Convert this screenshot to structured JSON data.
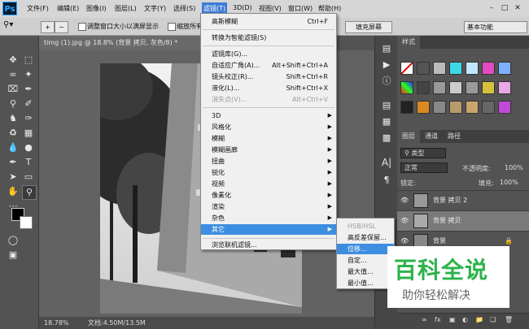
{
  "app": {
    "logo": "Ps"
  },
  "menubar": {
    "items": [
      "文件(F)",
      "编辑(E)",
      "图像(I)",
      "图层(L)",
      "文字(Y)",
      "选择(S)",
      "滤镜(T)",
      "3D(D)",
      "视图(V)",
      "窗口(W)",
      "帮助(H)"
    ],
    "active": "滤镜(T)"
  },
  "options": {
    "resize_windows": "调整窗口大小以满屏显示",
    "zoom_all": "缩放所有窗口",
    "fill_screen": "填充屏幕",
    "workspace": "基本功能"
  },
  "document": {
    "tab_title": "timg (1).jpg @ 18.8% (背景 拷贝, 灰色/8) *",
    "zoom": "18.78%",
    "doc_size": "文档:4.50M/13.5M"
  },
  "filter_menu": {
    "items": [
      {
        "label": "高斯模糊",
        "shortcut": "Ctrl+F"
      },
      {
        "label": "转换为智能滤镜(S)"
      },
      {
        "label": "滤镜库(G)..."
      },
      {
        "label": "自适应广角(A)...",
        "shortcut": "Alt+Shift+Ctrl+A"
      },
      {
        "label": "镜头校正(R)...",
        "shortcut": "Shift+Ctrl+R"
      },
      {
        "label": "液化(L)...",
        "shortcut": "Shift+Ctrl+X"
      },
      {
        "label": "消失点(V)...",
        "shortcut": "Alt+Ctrl+V"
      },
      {
        "label": "3D"
      },
      {
        "label": "风格化"
      },
      {
        "label": "模糊"
      },
      {
        "label": "模糊画廊"
      },
      {
        "label": "扭曲"
      },
      {
        "label": "锐化"
      },
      {
        "label": "视频"
      },
      {
        "label": "像素化"
      },
      {
        "label": "渲染"
      },
      {
        "label": "杂色"
      },
      {
        "label": "其它"
      },
      {
        "label": "浏览联机滤镜..."
      }
    ]
  },
  "other_submenu": {
    "items": [
      "HSB/HSL",
      "高反差保留...",
      "位移...",
      "自定...",
      "最大值...",
      "最小值..."
    ]
  },
  "styles_panel": {
    "title": "样式"
  },
  "layers_panel": {
    "tabs": [
      "图层",
      "通道",
      "路径"
    ],
    "kind_label": "类型",
    "blend_mode": "正常",
    "opacity_label": "不透明度:",
    "opacity_value": "100%",
    "lock_label": "锁定:",
    "fill_label": "填充:",
    "fill_value": "100%",
    "layers": [
      {
        "name": "背景 拷贝 2",
        "selected": false
      },
      {
        "name": "背景 拷贝",
        "selected": true
      },
      {
        "name": "背景",
        "selected": false
      }
    ]
  },
  "watermark": {
    "title": "百科全说",
    "subtitle": "助你轻松解决"
  },
  "colors": {
    "menu_highlight": "#3d8ee0",
    "watermark_green": "#2cb34a"
  }
}
